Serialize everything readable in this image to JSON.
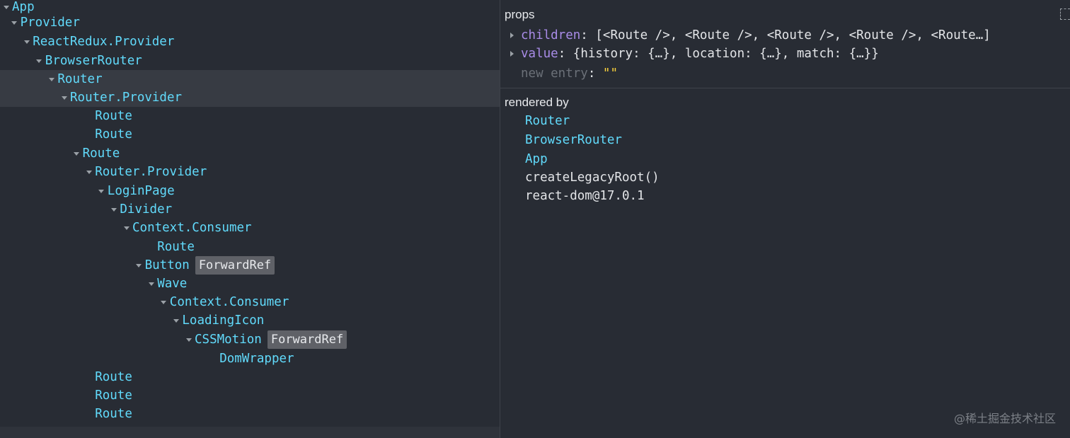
{
  "tree": {
    "rows": [
      {
        "label": "App",
        "badge": "",
        "expanded": true
      },
      {
        "label": "Provider",
        "badge": "",
        "expanded": true
      },
      {
        "label": "ReactRedux.Provider",
        "badge": "",
        "expanded": true
      },
      {
        "label": "BrowserRouter",
        "badge": "",
        "expanded": true
      },
      {
        "label": "Router",
        "badge": "",
        "expanded": true,
        "selected": true
      },
      {
        "label": "Router.Provider",
        "badge": "",
        "expanded": true,
        "selected": true
      },
      {
        "label": "Route",
        "badge": "",
        "expanded": false
      },
      {
        "label": "Route",
        "badge": "",
        "expanded": false
      },
      {
        "label": "Route",
        "badge": "",
        "expanded": true
      },
      {
        "label": "Router.Provider",
        "badge": "",
        "expanded": true
      },
      {
        "label": "LoginPage",
        "badge": "",
        "expanded": true
      },
      {
        "label": "Divider",
        "badge": "",
        "expanded": true
      },
      {
        "label": "Context.Consumer",
        "badge": "",
        "expanded": true
      },
      {
        "label": "Route",
        "badge": "",
        "expanded": false
      },
      {
        "label": "Button",
        "badge": "ForwardRef",
        "expanded": true
      },
      {
        "label": "Wave",
        "badge": "",
        "expanded": true
      },
      {
        "label": "Context.Consumer",
        "badge": "",
        "expanded": true
      },
      {
        "label": "LoadingIcon",
        "badge": "",
        "expanded": true
      },
      {
        "label": "CSSMotion",
        "badge": "ForwardRef",
        "expanded": true
      },
      {
        "label": "DomWrapper",
        "badge": "",
        "expanded": false
      },
      {
        "label": "Route",
        "badge": "",
        "expanded": false
      },
      {
        "label": "Route",
        "badge": "",
        "expanded": false
      },
      {
        "label": "Route",
        "badge": "",
        "expanded": false
      }
    ]
  },
  "props": {
    "title": "props",
    "children": {
      "key": "children",
      "sep": ":",
      "value": "[<Route />, <Route />, <Route />, <Route />, <Route…]"
    },
    "value": {
      "key": "value",
      "sep": ":",
      "value": "{history: {…}, location: {…}, match: {…}}"
    },
    "new_entry": {
      "key": "new entry",
      "sep": ":",
      "value": "\"\""
    }
  },
  "rendered_by": {
    "title": "rendered by",
    "owners": [
      {
        "label": "Router",
        "kind": "component"
      },
      {
        "label": "BrowserRouter",
        "kind": "component"
      },
      {
        "label": "App",
        "kind": "component"
      },
      {
        "label": "createLegacyRoot()",
        "kind": "plain"
      },
      {
        "label": "react-dom@17.0.1",
        "kind": "plain"
      }
    ]
  },
  "toolbar": {
    "inspect_icon": "inspect-dom-icon"
  },
  "watermark": "@稀土掘金技术社区",
  "colors": {
    "background": "#282c34",
    "component": "#61dafb",
    "prop_key": "#a98ce8",
    "string_value": "#ffd43b",
    "badge_bg": "#5f6167"
  }
}
